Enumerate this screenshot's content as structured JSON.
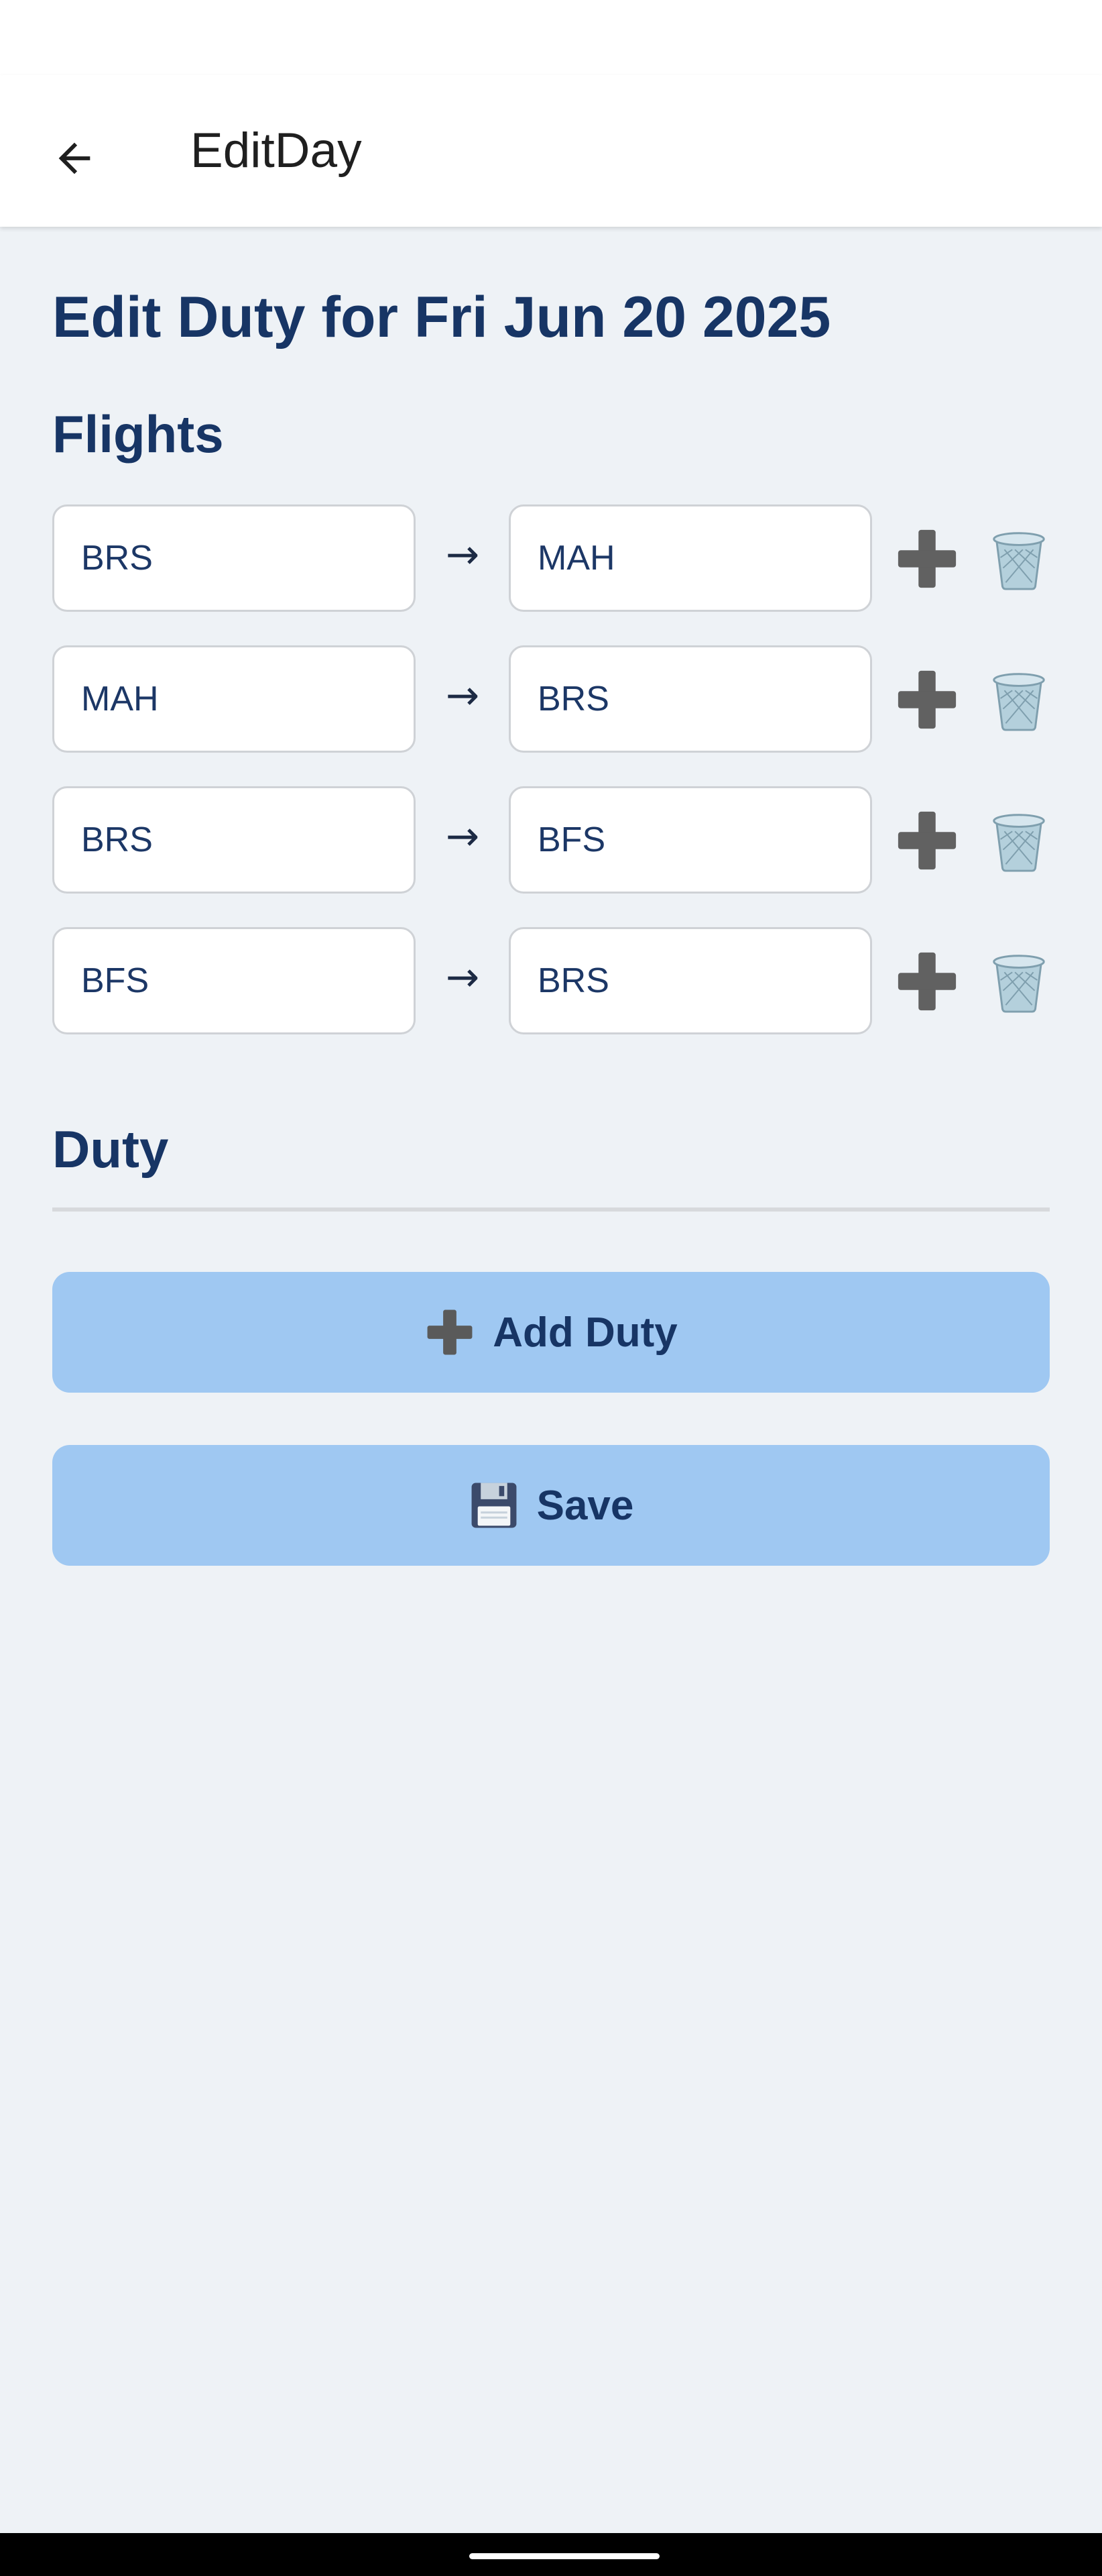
{
  "app_bar": {
    "title": "EditDay",
    "back_icon": "arrow-left-icon"
  },
  "page": {
    "heading": "Edit Duty for Fri Jun 20 2025"
  },
  "flights": {
    "heading": "Flights",
    "arrow": "→",
    "add_icon": "plus-icon",
    "delete_icon": "trash-icon",
    "rows": [
      {
        "from": "BRS",
        "to": "MAH"
      },
      {
        "from": "MAH",
        "to": "BRS"
      },
      {
        "from": "BRS",
        "to": "BFS"
      },
      {
        "from": "BFS",
        "to": "BRS"
      }
    ]
  },
  "duty": {
    "heading": "Duty"
  },
  "buttons": {
    "add_duty": {
      "icon": "plus-icon",
      "label": "Add Duty"
    },
    "save": {
      "icon": "floppy-disk-icon",
      "label": "Save"
    }
  },
  "colors": {
    "background": "#eef2f6",
    "heading": "#173565",
    "button_bg": "#9fc8f2"
  }
}
